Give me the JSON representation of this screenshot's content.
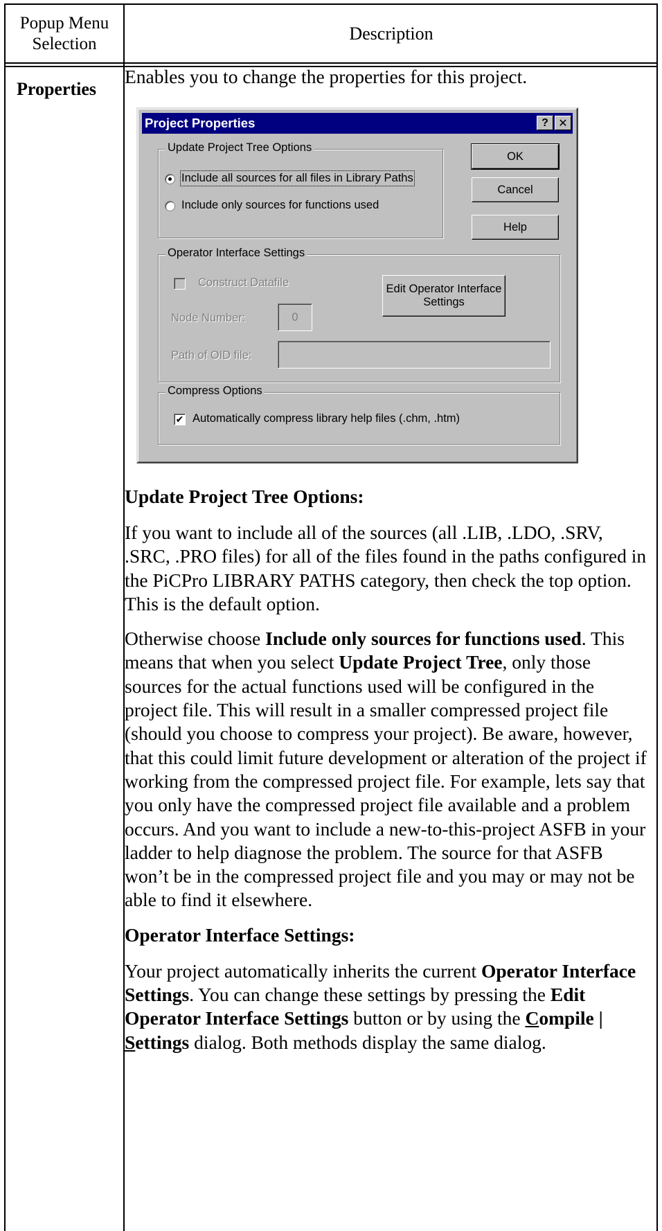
{
  "table": {
    "col1_header": "Popup Menu Selection",
    "col2_header": "Description",
    "selection": "Properties",
    "intro": "Enables you to change the properties for this project."
  },
  "dialog": {
    "title": "Project Properties",
    "help_btn": "?",
    "close_btn": "✕",
    "group_update": "Update Project Tree Options",
    "radio_all": "Include all sources for all files in Library Paths",
    "radio_used": "Include only sources for functions used",
    "ok": "OK",
    "cancel": "Cancel",
    "help": "Help",
    "group_oi": "Operator Interface Settings",
    "construct_datafile": "Construct Datafile",
    "edit_oi_button": "Edit Operator Interface Settings",
    "node_number_label": "Node Number:",
    "node_number_value": "0",
    "oid_path_label": "Path of OID file:",
    "oid_path_value": "",
    "group_compress": "Compress Options",
    "compress_checkbox": "Automatically compress library help files (.chm, .htm)"
  },
  "section1": {
    "heading": "Update Project Tree Options:",
    "p1": "If you want to include all of the sources (all .LIB, .LDO, .SRV, .SRC, .PRO files) for all of the files found in the paths configured in the PiCPro LIBRARY PATHS category, then check the top option. This is the default option.",
    "p2_a": "Otherwise choose ",
    "p2_b": "Include only sources for functions used",
    "p2_c": ". This means that when you select ",
    "p2_d": "Update Project Tree",
    "p2_e": ", only those sources for the actual functions used will be configured in the project file. This will result in a smaller compressed project file (should you choose to compress your project). Be aware, however, that this could limit future development or alteration of the project if working from the compressed project file. For example, lets say that you only have the compressed project file available and a problem occurs. And you want to include a new-to-this-project ASFB in your ladder to help diagnose the problem. The source for that ASFB won’t be in the compressed project file and you may or may not be able to find it elsewhere."
  },
  "section2": {
    "heading": "Operator Interface Settings:",
    "p_a": "Your project automatically inherits the current ",
    "p_b": "Operator Interface Settings",
    "p_c": ". You can change these settings by pressing the ",
    "p_d": "Edit Operator Interface Settings",
    "p_e": " button or by using the ",
    "p_f1": "C",
    "p_f2": "ompile",
    "p_f3": " | ",
    "p_f4": "S",
    "p_f5": "ettings",
    "p_g": " dialog. Both methods display the same dialog."
  }
}
